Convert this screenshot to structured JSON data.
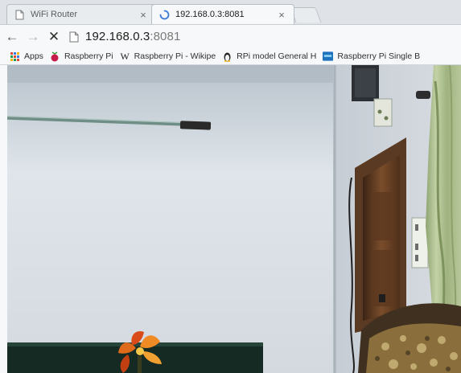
{
  "tabs": [
    {
      "title": "WiFi Router",
      "active": false,
      "close": "×"
    },
    {
      "title": "192.168.0.3:8081",
      "active": true,
      "close": "×",
      "loading": true
    }
  ],
  "toolbar": {
    "back_icon": "←",
    "forward_icon": "→",
    "stop_icon": "✕",
    "url_host": "192.168.0.3",
    "url_port": ":8081"
  },
  "bookmarks": [
    {
      "label": "Apps",
      "icon": "apps-grid-icon"
    },
    {
      "label": "Raspberry Pi",
      "icon": "raspberry-icon"
    },
    {
      "label": "Raspberry Pi - Wikipe",
      "icon": "wikipedia-icon",
      "icon_text": "W"
    },
    {
      "label": "RPi  model General H",
      "icon": "linux-tux-icon"
    },
    {
      "label": "Raspberry Pi Single B",
      "icon": "site-icon"
    }
  ],
  "colors": {
    "tabstrip": "#dfe3e8",
    "toolbar": "#f7f8f9",
    "loading_spinner": "#3a7bd5",
    "wall": "#d5dbe1",
    "curtain": "#a5b88a",
    "door": "#6b4428"
  }
}
